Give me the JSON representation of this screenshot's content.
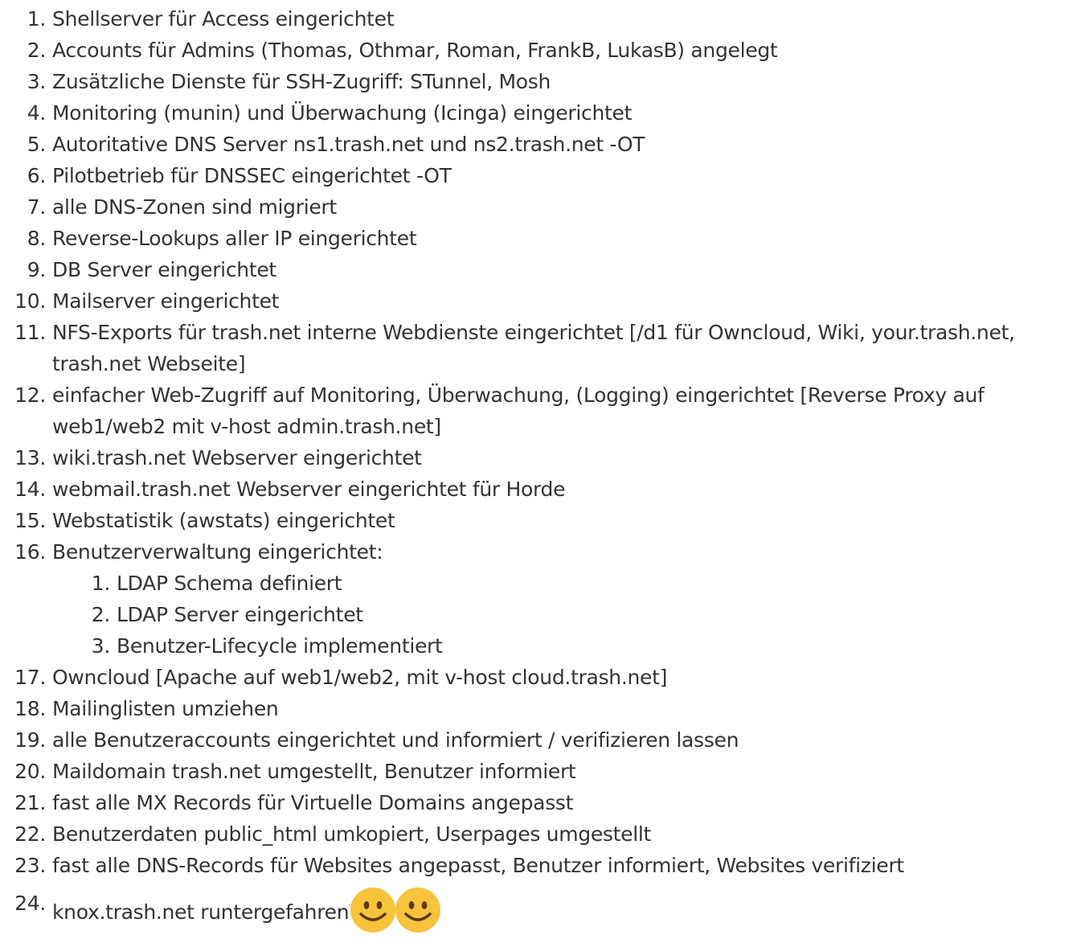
{
  "items": [
    {
      "num": "1.",
      "text": "Shellserver für Access eingerichtet"
    },
    {
      "num": "2.",
      "text": "Accounts für Admins (Thomas, Othmar, Roman, FrankB, LukasB) angelegt"
    },
    {
      "num": "3.",
      "text": "Zusätzliche Dienste für SSH-Zugriff: STunnel, Mosh"
    },
    {
      "num": "4.",
      "text": "Monitoring (munin) und Überwachung (Icinga) eingerichtet"
    },
    {
      "num": "5.",
      "text": "Autoritative DNS Server ns1.trash.net und ns2.trash.net -OT"
    },
    {
      "num": "6.",
      "text": "Pilotbetrieb für DNSSEC eingerichtet -OT"
    },
    {
      "num": "7.",
      "text": "alle DNS-Zonen sind migriert"
    },
    {
      "num": "8.",
      "text": "Reverse-Lookups aller IP eingerichtet"
    },
    {
      "num": "9.",
      "text": "DB Server eingerichtet"
    },
    {
      "num": "10.",
      "text": "Mailserver eingerichtet"
    },
    {
      "num": "11.",
      "text": "NFS-Exports für trash.net interne Webdienste eingerichtet [/d1 für Owncloud, Wiki, your.trash.net, trash.net Webseite]"
    },
    {
      "num": "12.",
      "text": "einfacher Web-Zugriff auf Monitoring, Überwachung, (Logging) eingerichtet [Reverse Proxy auf web1/web2 mit v-host admin.trash.net]"
    },
    {
      "num": "13.",
      "text": "wiki.trash.net Webserver eingerichtet"
    },
    {
      "num": "14.",
      "text": "webmail.trash.net Webserver eingerichtet für Horde"
    },
    {
      "num": "15.",
      "text": "Webstatistik (awstats) eingerichtet"
    },
    {
      "num": "16.",
      "text": "Benutzerverwaltung eingerichtet:"
    }
  ],
  "subitems": [
    {
      "num": "1.",
      "text": "LDAP Schema definiert"
    },
    {
      "num": "2.",
      "text": "LDAP Server eingerichtet"
    },
    {
      "num": "3.",
      "text": "Benutzer-Lifecycle implementiert"
    }
  ],
  "items_after": [
    {
      "num": "17.",
      "text": "Owncloud [Apache auf web1/web2, mit v-host cloud.trash.net]"
    },
    {
      "num": "18.",
      "text": "Mailinglisten umziehen"
    },
    {
      "num": "19.",
      "text": "alle Benutzeraccounts eingerichtet und informiert / verifizieren lassen"
    },
    {
      "num": "20.",
      "text": "Maildomain trash.net umgestellt, Benutzer informiert"
    },
    {
      "num": "21.",
      "text": "fast alle MX Records für Virtuelle Domains angepasst"
    },
    {
      "num": "22.",
      "text": "Benutzerdaten public_html umkopiert, Userpages umgestellt"
    },
    {
      "num": "23.",
      "text": "fast alle DNS-Records für Websites angepasst, Benutzer informiert, Websites verifiziert"
    }
  ],
  "last_item": {
    "num": "24.",
    "text": "knox.trash.net runtergefahren"
  },
  "icons": {
    "smiley": "smiley-icon",
    "smiley_face_color": "#F7C33A",
    "smiley_feature_color": "#5A3A12"
  }
}
